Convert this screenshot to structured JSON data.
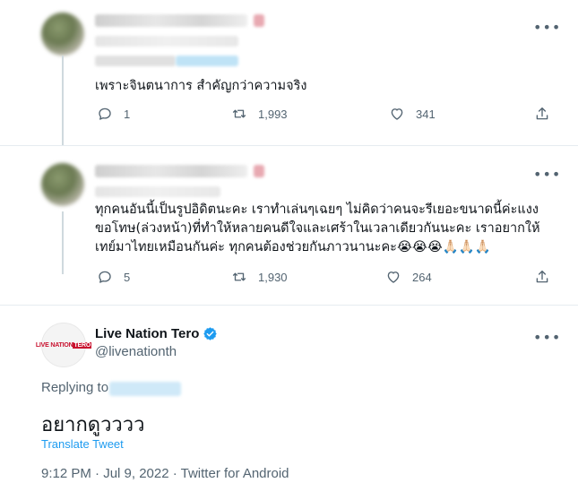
{
  "tweets": [
    {
      "text_lines": [
        "เพราะจินตนาการ สำคัญกว่าความจริง"
      ],
      "more_label": "•••",
      "reply_count": "1",
      "retweet_count": "1,993",
      "like_count": "341"
    },
    {
      "text_lines": [
        "ทุกคนอันนี้เป็นรูปอิดิตนะคะ เราทำเล่นๆเฉยๆ ไม่คิดว่าคนจะรีเยอะขนาดนี้ค่ะแงง",
        "ขอโทษ(ล่วงหน้า)ที่ทำให้หลายคนดีใจและเศร้าในเวลาเดียวกันนะคะ เราอยากให้",
        "เทย์มาไทยเหมือนกันค่ะ ทุกคนต้องช่วยกันภาวนานะคะ😭😭😭🙏🏻🙏🏻🙏🏻"
      ],
      "more_label": "•••",
      "reply_count": "5",
      "retweet_count": "1,930",
      "like_count": "264"
    }
  ],
  "main_tweet": {
    "logo_text_a": "LIVE NATION",
    "logo_text_b": "TERO",
    "display_name": "Live Nation Tero",
    "handle": "@livenationth",
    "more_label": "•••",
    "replying_label": "Replying to",
    "text": "อยากดูวววว",
    "translate_label": "Translate Tweet",
    "meta": "9:12 PM · Jul 9, 2022 · Twitter for Android"
  },
  "colors": {
    "accent": "#1d9bf0",
    "muted": "#536471",
    "text": "#0f1419",
    "logo_red": "#c8102e"
  }
}
